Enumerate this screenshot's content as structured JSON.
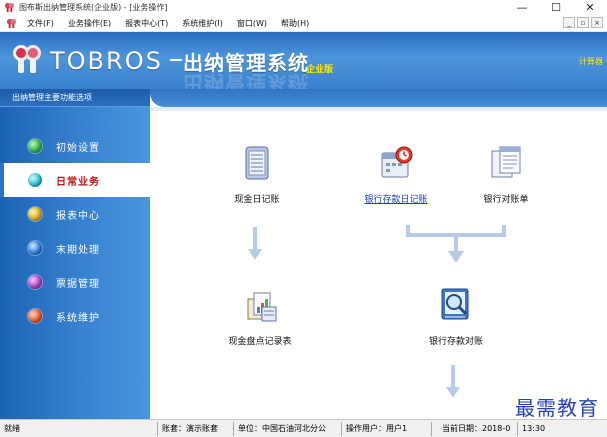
{
  "window": {
    "title": "图布斯出纳管理系统(企业版) - [业务操作]",
    "controls": [
      "—",
      "☐",
      "✕"
    ]
  },
  "menu": {
    "items": [
      "文件(F)",
      "业务操作(E)",
      "报表中心(T)",
      "系统维护(I)",
      "窗口(W)",
      "帮助(H)"
    ],
    "mdi_controls": [
      "_",
      "▫",
      "×"
    ]
  },
  "banner": {
    "brand": "TOBROS",
    "product": "出纳管理系统",
    "edition": "企业版",
    "right_text": "计算器"
  },
  "sidebar": {
    "title": "出纳管理主要功能选项",
    "items": [
      {
        "label": "初始设置",
        "color": "#2fb54a"
      },
      {
        "label": "日常业务",
        "color": "#27c0d6",
        "active": true
      },
      {
        "label": "报表中心",
        "color": "#e2b21c"
      },
      {
        "label": "末期处理",
        "color": "#2a7fe0"
      },
      {
        "label": "票据管理",
        "color": "#b33fc4"
      },
      {
        "label": "系统维护",
        "color": "#ef5a2c"
      }
    ]
  },
  "features": {
    "cash_journal": "现金日记账",
    "bank_journal": "银行存款日记账",
    "bank_statement": "银行对账单",
    "cash_count": "现金盘点记录表",
    "bank_reconcile": "银行存款对账"
  },
  "status": {
    "ready": "就绪",
    "account": "账套：演示账套",
    "unit": "单位：中国石油河北分公",
    "user": "操作用户：用户1",
    "date": "当前日期：2018-0",
    "time": "13:30"
  },
  "watermark": "最需教育",
  "colors": {
    "accent": "#3a85d2",
    "active_text": "#c21515",
    "link": "#1a3fb8"
  }
}
